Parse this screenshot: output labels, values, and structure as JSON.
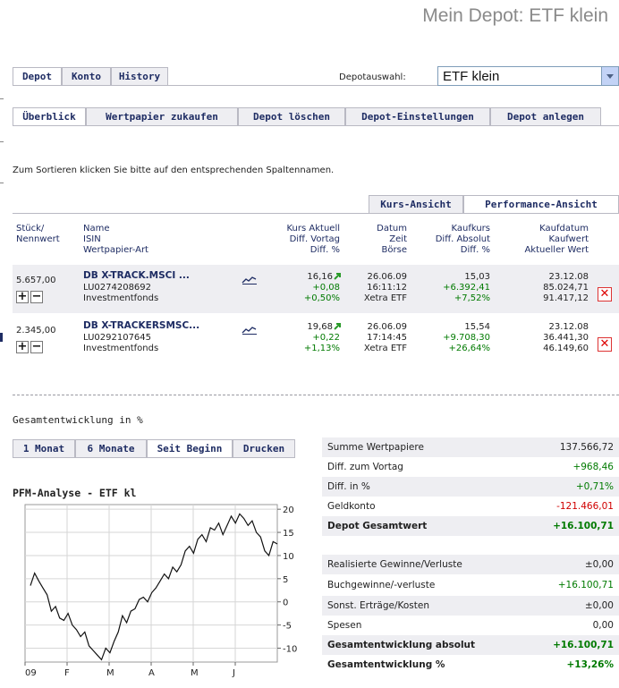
{
  "page": {
    "title": "Mein Depot: ETF klein"
  },
  "main_tabs": [
    {
      "label": "Depot"
    },
    {
      "label": "Konto"
    },
    {
      "label": "History"
    }
  ],
  "depot_select": {
    "label": "Depotauswahl:",
    "value": "ETF klein"
  },
  "sub_tabs": [
    {
      "label": "Überblick"
    },
    {
      "label": "Wertpapier zukaufen"
    },
    {
      "label": "Depot löschen"
    },
    {
      "label": "Depot-Einstellungen"
    },
    {
      "label": "Depot anlegen"
    }
  ],
  "sort_hint": "Zum Sortieren klicken Sie bitte auf den entsprechenden Spaltennamen.",
  "view_tabs": [
    {
      "label": "Kurs-Ansicht"
    },
    {
      "label": "Performance-Ansicht"
    }
  ],
  "table": {
    "headers": {
      "col1": [
        "Stück/",
        "Nennwert"
      ],
      "col2": [
        "Name",
        "ISIN",
        "Wertpapier-Art"
      ],
      "col3": [
        "Kurs Aktuell",
        "Diff. Vortag",
        "Diff. %"
      ],
      "col4": [
        "Datum",
        "Zeit",
        "Börse"
      ],
      "col5": [
        "Kaufkurs",
        "Diff. Absolut",
        "Diff. %"
      ],
      "col6": [
        "Kaufdatum",
        "Kaufwert",
        "Aktueller Wert"
      ]
    },
    "rows": [
      {
        "qty": "5.657,00",
        "name": "DB X-TRACK.MSCI ...",
        "isin": "LU0274208692",
        "type": "Investmentfonds",
        "kurs": "16,16",
        "diff_vortag": "+0,08",
        "diff_pct": "+0,50%",
        "datum": "26.06.09",
        "zeit": "16:11:12",
        "boerse": "Xetra ETF",
        "kaufkurs": "15,03",
        "diff_abs": "+6.392,41",
        "diff_pct2": "+7,52%",
        "kaufdatum": "23.12.08",
        "kaufwert": "85.024,71",
        "akt_wert": "91.417,12"
      },
      {
        "qty": "2.345,00",
        "name": "DB X-TRACKERSMSC...",
        "isin": "LU0292107645",
        "type": "Investmentfonds",
        "kurs": "19,68",
        "diff_vortag": "+0,22",
        "diff_pct": "+1,13%",
        "datum": "26.06.09",
        "zeit": "17:14:45",
        "boerse": "Xetra ETF",
        "kaufkurs": "15,54",
        "diff_abs": "+9.708,30",
        "diff_pct2": "+26,64%",
        "kaufdatum": "23.12.08",
        "kaufwert": "36.441,30",
        "akt_wert": "46.149,60"
      }
    ]
  },
  "gesamt": {
    "heading": "Gesamtentwicklung in %",
    "tabs": [
      {
        "label": "1 Monat"
      },
      {
        "label": "6 Monate"
      },
      {
        "label": "Seit Beginn"
      },
      {
        "label": "Drucken"
      }
    ],
    "chart_title": "PFM-Analyse - ETF kl"
  },
  "summary": [
    {
      "label": "Summe Wertpapiere",
      "value": "137.566,72"
    },
    {
      "label": "Diff. zum Vortag",
      "value": "+968,46"
    },
    {
      "label": "Diff. in %",
      "value": "+0,71%"
    },
    {
      "label": "Geldkonto",
      "value": "-121.466,01"
    },
    {
      "label": "Depot Gesamtwert",
      "value": "+16.100,71"
    },
    {
      "label": "Realisierte Gewinne/Verluste",
      "value": "±0,00"
    },
    {
      "label": "Buchgewinne/-verluste",
      "value": "+16.100,71"
    },
    {
      "label": "Sonst. Erträge/Kosten",
      "value": "±0,00"
    },
    {
      "label": "Spesen",
      "value": "0,00"
    },
    {
      "label": "Gesamtentwicklung absolut",
      "value": "+16.100,71"
    },
    {
      "label": "Gesamtentwicklung %",
      "value": "+13,26%"
    }
  ],
  "colors": {
    "navy": "#1e2c63",
    "green": "#007a00",
    "red": "#d00000",
    "shade": "#eeeef2"
  },
  "chart_data": {
    "type": "line",
    "title": "PFM-Analyse - ETF kl",
    "x": [
      "09",
      "F",
      "M",
      "A",
      "M",
      "J"
    ],
    "ylim": [
      -13,
      21
    ],
    "yticks": [
      20,
      15,
      10,
      5,
      0,
      -5,
      -10
    ],
    "grid": true,
    "series": [
      {
        "values": [
          3.5,
          6.2,
          4.5,
          3.0,
          1.5,
          -2.0,
          -1.0,
          -3.5,
          -4.0,
          -2.5,
          -5.0,
          -6.0,
          -7.5,
          -6.5,
          -9.5,
          -10.5,
          -11.5,
          -12.5,
          -10.0,
          -11.0,
          -8.5,
          -6.5,
          -3.0,
          -4.5,
          -2.0,
          -1.5,
          0.5,
          1.0,
          0.0,
          2.0,
          3.0,
          4.5,
          6.0,
          5.0,
          7.5,
          6.5,
          8.0,
          11.0,
          12.0,
          10.5,
          13.5,
          14.5,
          13.0,
          16.0,
          15.5,
          17.0,
          14.5,
          16.5,
          18.5,
          17.0,
          19.0,
          18.0,
          16.5,
          17.5,
          15.0,
          14.0,
          11.0,
          10.0,
          13.0,
          12.5
        ]
      }
    ]
  }
}
